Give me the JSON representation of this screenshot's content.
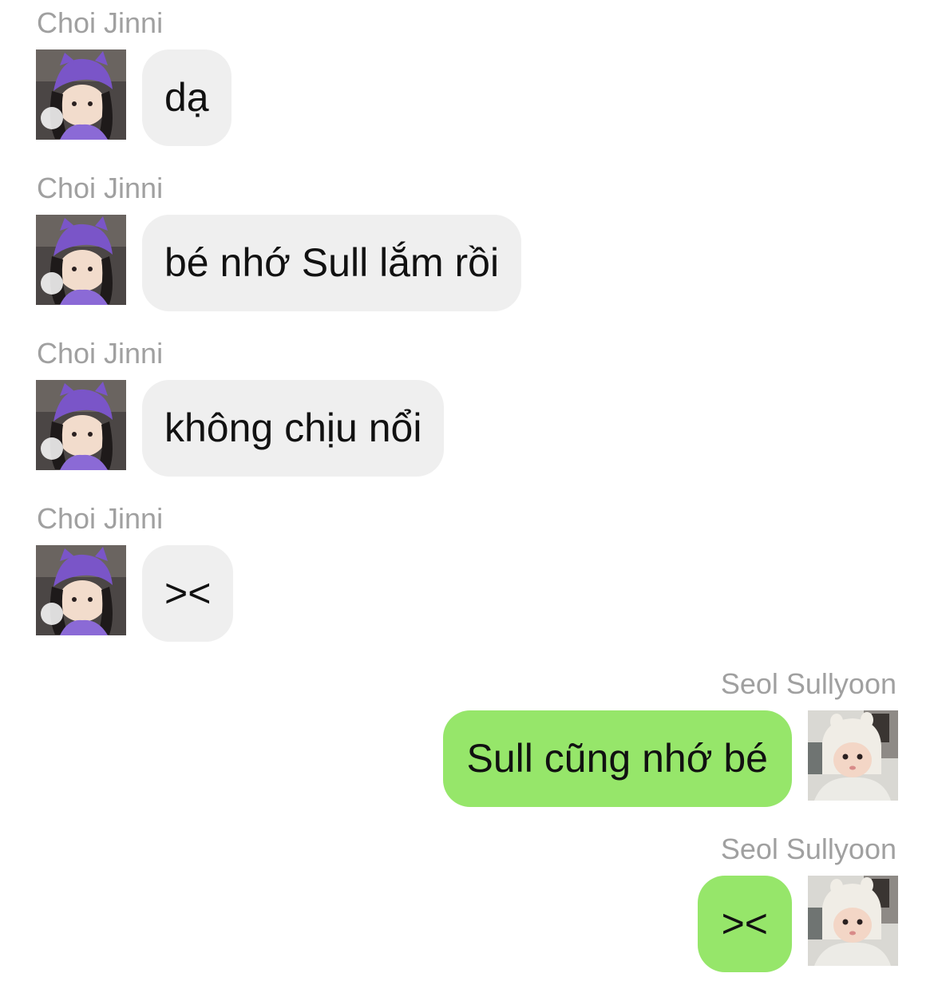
{
  "chat": {
    "messages": [
      {
        "sender": "Choi Jinni",
        "side": "left",
        "text": "dạ"
      },
      {
        "sender": "Choi Jinni",
        "side": "left",
        "text": "bé nhớ Sull lắm rồi"
      },
      {
        "sender": "Choi Jinni",
        "side": "left",
        "text": "không chịu nổi"
      },
      {
        "sender": "Choi Jinni",
        "side": "left",
        "text": "><"
      },
      {
        "sender": "Seol Sullyoon",
        "side": "right",
        "text": "Sull cũng nhớ bé"
      },
      {
        "sender": "Seol Sullyoon",
        "side": "right",
        "text": "><"
      }
    ]
  },
  "colors": {
    "incoming_bubble": "#efefef",
    "outgoing_bubble": "#96e66a",
    "sender_name": "#a0a0a0",
    "message_text": "#111111"
  },
  "icons": {
    "jinni_avatar": "avatar-girl-purple-hat",
    "sullyoon_avatar": "avatar-baby-white-hood"
  }
}
